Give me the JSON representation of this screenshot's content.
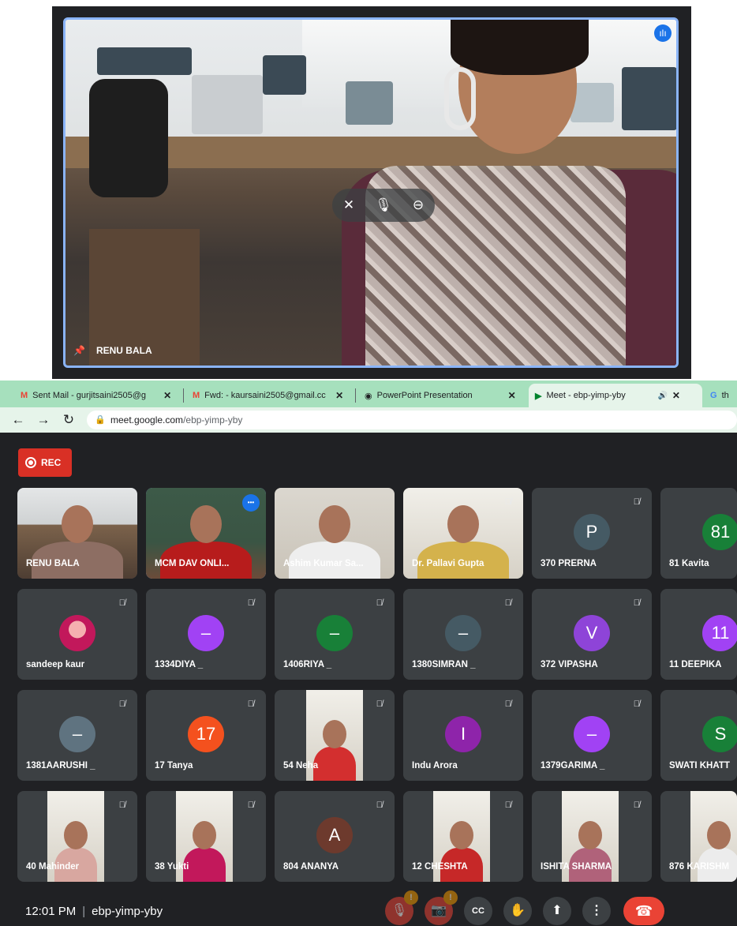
{
  "speaker": {
    "name": "RENU BALA"
  },
  "browser": {
    "tabs": [
      {
        "label": "Sent Mail - gurjitsaini2505@g",
        "icon": "gmail-icon"
      },
      {
        "label": "Fwd: - kaursaini2505@gmail.cc",
        "icon": "gmail-icon"
      },
      {
        "label": "PowerPoint Presentation",
        "icon": "globe-icon"
      },
      {
        "label": "Meet - ebp-yimp-yby",
        "icon": "meet-icon",
        "active": true
      },
      {
        "label": "th",
        "icon": "google-icon"
      }
    ],
    "url_host": "meet.google.com",
    "url_path": "/ebp-yimp-yby"
  },
  "meet": {
    "rec_label": "REC",
    "tiles": [
      {
        "name": "RENU BALA",
        "type": "video",
        "muted": false
      },
      {
        "name": "MCM DAV ONLI...",
        "type": "video",
        "muted": false,
        "active": true
      },
      {
        "name": "Ashim Kumar Sa...",
        "type": "video",
        "muted": false
      },
      {
        "name": "Dr. Pallavi Gupta",
        "type": "video",
        "muted": true
      },
      {
        "name": "370 PRERNA",
        "type": "avatar",
        "initial": "P",
        "color": "#455a64",
        "muted": true
      },
      {
        "name": "81 Kavita",
        "type": "avatar",
        "initial": "81",
        "color": "#188038",
        "muted": false
      },
      {
        "name": "sandeep kaur",
        "type": "photo-avatar",
        "muted": true
      },
      {
        "name": "1334DIYA _",
        "type": "avatar",
        "initial": "–",
        "color": "#a142f4",
        "muted": true
      },
      {
        "name": "1406RIYA _",
        "type": "avatar",
        "initial": "–",
        "color": "#188038",
        "muted": true
      },
      {
        "name": "1380SIMRAN _",
        "type": "avatar",
        "initial": "–",
        "color": "#455a64",
        "muted": true
      },
      {
        "name": "372 VIPASHA",
        "type": "avatar",
        "initial": "V",
        "color": "#8e44d8",
        "muted": true
      },
      {
        "name": "11 DEEPIKA",
        "type": "avatar",
        "initial": "11",
        "color": "#a142f4",
        "muted": false
      },
      {
        "name": "1381AARUSHI _",
        "type": "avatar",
        "initial": "–",
        "color": "#5f7380",
        "muted": true
      },
      {
        "name": "17 Tanya",
        "type": "avatar",
        "initial": "17",
        "color": "#f4511e",
        "muted": true
      },
      {
        "name": "54 Neha",
        "type": "video",
        "muted": true
      },
      {
        "name": "Indu Arora",
        "type": "avatar",
        "initial": "I",
        "color": "#8e24aa",
        "muted": true
      },
      {
        "name": "1379GARIMA _",
        "type": "avatar",
        "initial": "–",
        "color": "#a142f4",
        "muted": true
      },
      {
        "name": "SWATI KHATT",
        "type": "avatar",
        "initial": "S",
        "color": "#188038",
        "muted": false
      },
      {
        "name": "40 Mahinder",
        "type": "video",
        "muted": true
      },
      {
        "name": "38 Yukti",
        "type": "video",
        "muted": true
      },
      {
        "name": "804 ANANYA",
        "type": "avatar",
        "initial": "A",
        "color": "#6d3a2d",
        "muted": true
      },
      {
        "name": "12 CHESHTA",
        "type": "video",
        "muted": true
      },
      {
        "name": "ISHITA SHARMA",
        "type": "video",
        "muted": true
      },
      {
        "name": "876 KARISHM",
        "type": "video",
        "muted": false
      }
    ],
    "bottom": {
      "time": "12:01 PM",
      "meeting_code": "ebp-yimp-yby",
      "warning_badge": "!"
    }
  },
  "colors": {
    "meet_bg": "#202124",
    "tile_bg": "#3c4043",
    "accent_blue": "#8ab4f8",
    "rec_red": "#d93025",
    "tab_green": "#a6e0bd"
  }
}
